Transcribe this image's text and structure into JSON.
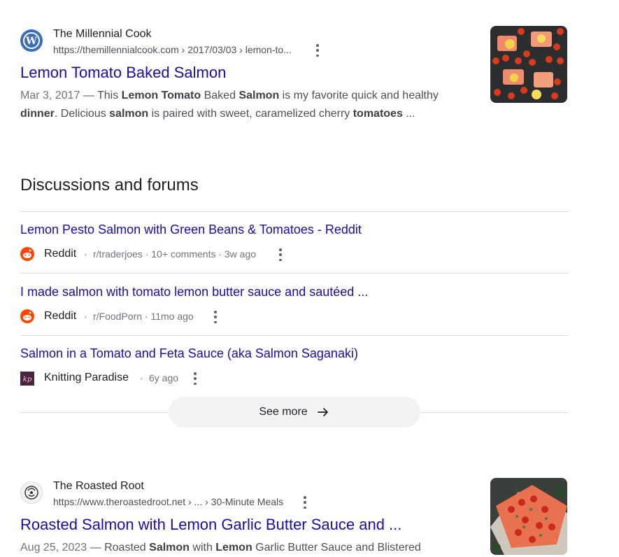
{
  "results": [
    {
      "site_name": "The Millennial Cook",
      "url": "https://themillennialcook.com › 2017/03/03 › lemon-to...",
      "title": "Lemon Tomato Baked Salmon",
      "date": "Mar 3, 2017",
      "snippet_parts": [
        " — This ",
        "Lemon Tomato",
        " Baked ",
        "Salmon",
        " is my favorite quick and healthy ",
        "dinner",
        ". Delicious ",
        "salmon",
        " is paired with sweet, caramelized cherry ",
        "tomatoes",
        " ..."
      ],
      "favicon": "wordpress-icon"
    },
    {
      "site_name": "The Roasted Root",
      "url": "https://www.theroastedroot.net › ... › 30-Minute Meals",
      "title": "Roasted Salmon with Lemon Garlic Butter Sauce and ...",
      "date": "Aug 25, 2023",
      "snippet_parts": [
        " — Roasted ",
        "Salmon",
        " with ",
        "Lemon",
        " Garlic Butter Sauce and Blistered"
      ],
      "favicon": "roasted-root-icon"
    }
  ],
  "discussions": {
    "heading": "Discussions and forums",
    "items": [
      {
        "title": "Lemon Pesto Salmon with Green Beans & Tomatoes - Reddit",
        "source": "Reddit",
        "meta": "r/traderjoes · 10+ comments · 3w ago",
        "icon": "reddit-icon"
      },
      {
        "title": "I made salmon with tomato lemon butter sauce and sautéed ...",
        "source": "Reddit",
        "meta": "r/FoodPorn · 11mo ago",
        "icon": "reddit-icon"
      },
      {
        "title": "Salmon in a Tomato and Feta Sauce (aka Salmon Saganaki)",
        "source": "Knitting Paradise",
        "meta": "6y ago",
        "icon": "knitting-paradise-icon"
      }
    ],
    "see_more_label": "See more"
  },
  "sep": "·",
  "colors": {
    "link": "#1a0dab",
    "reddit": "#ff4500",
    "divider": "#dadce0"
  }
}
